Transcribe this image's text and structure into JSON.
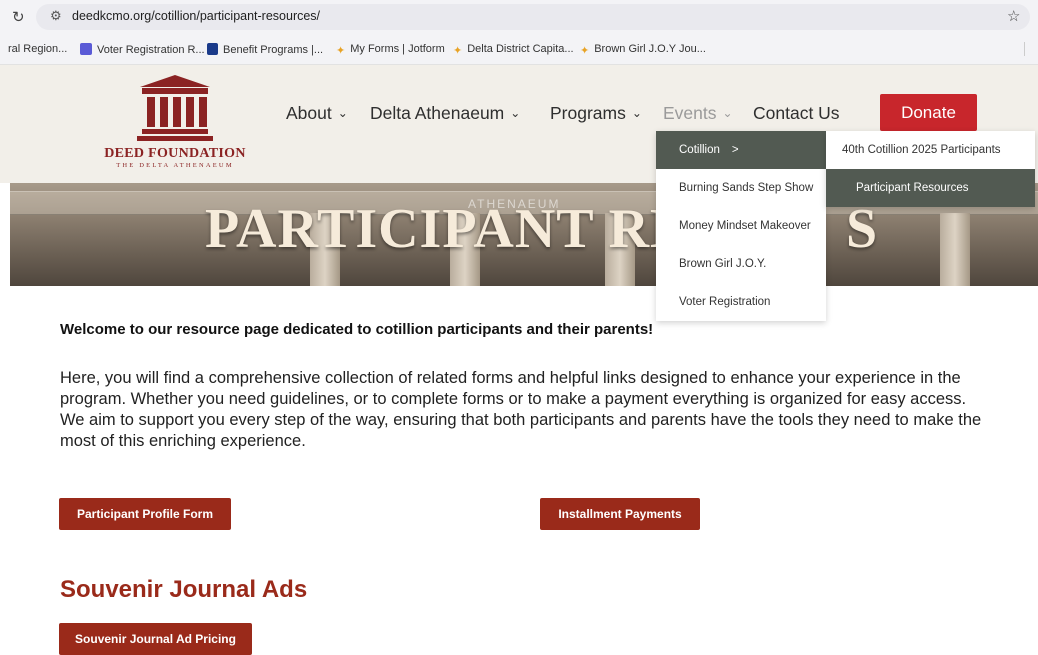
{
  "browser": {
    "url": "deedkcmo.org/cotillion/participant-resources/",
    "bookmarks": [
      "ral Region...",
      "Voter Registration R...",
      "Benefit Programs |...",
      "My Forms | Jotform",
      "Delta District Capita...",
      "Brown Girl J.O.Y Jou..."
    ]
  },
  "site": {
    "brand": "DEED FOUNDATION",
    "tagline": "THE DELTA ATHENAEUM",
    "nav": {
      "about": "About",
      "athenaeum": "Delta Athenaeum",
      "programs": "Programs",
      "events": "Events",
      "contact": "Contact Us",
      "donate": "Donate"
    }
  },
  "hero": {
    "title": "PARTICIPANT RES",
    "title_tail": "S",
    "inscription": "ATHENAEUM"
  },
  "events_menu": {
    "items": [
      "Cotillion",
      "Burning Sands Step Show",
      "Money Mindset Makeover",
      "Brown Girl J.O.Y.",
      "Voter Registration"
    ],
    "arrow": ">",
    "submenu": [
      "40th Cotillion 2025 Participants",
      "Participant Resources"
    ]
  },
  "content": {
    "welcome": "Welcome to our resource page dedicated to cotillion participants and their parents!",
    "paragraph": "Here, you will find a comprehensive collection of related forms and helpful links designed to enhance your experience in the program. Whether you need guidelines, or to complete forms or to make a payment everything is organized for easy access. We aim to support you every step of the way, ensuring that both participants and parents have the tools they need to make the most of this enriching experience.",
    "buttons": {
      "profile": "Participant Profile Form",
      "installment": "Installment Payments",
      "souvenir": "Souvenir Journal Ad Pricing"
    },
    "souvenir_heading": "Souvenir Journal Ads"
  },
  "colors": {
    "accent": "#9a2a1a",
    "donate": "#c8262c",
    "menu_active": "#525a52"
  }
}
